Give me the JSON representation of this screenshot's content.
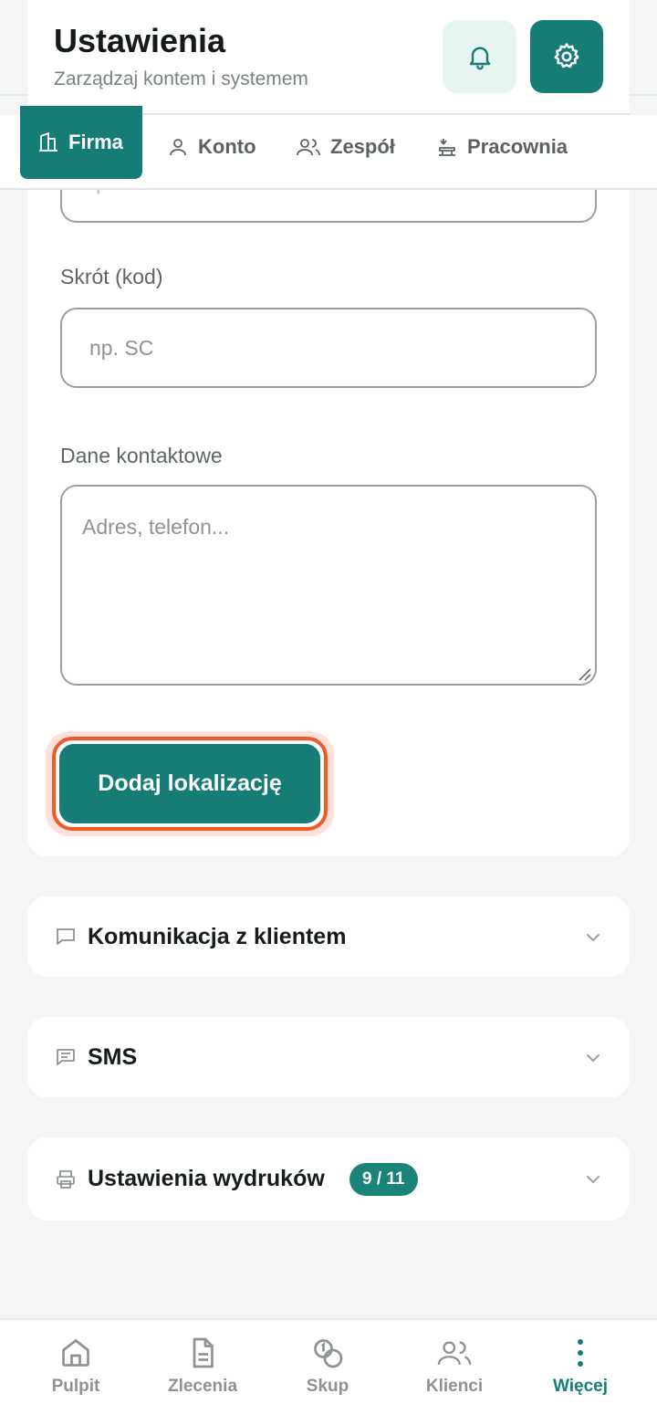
{
  "header": {
    "title": "Ustawienia",
    "subtitle": "Zarządzaj kontem i systemem",
    "bell_icon": "bell-icon",
    "settings_icon": "gear-icon"
  },
  "tabs": [
    {
      "label": "Firma",
      "icon": "building-icon",
      "active": true
    },
    {
      "label": "Konto",
      "icon": "user-icon",
      "active": false
    },
    {
      "label": "Zespół",
      "icon": "users-icon",
      "active": false
    },
    {
      "label": "Pracownia",
      "icon": "workbench-icon",
      "active": false
    }
  ],
  "form": {
    "partial_field_placeholder": "np. Serwis Centrum",
    "code_label": "Skrót (kod)",
    "code_placeholder": "np. SC",
    "contact_label": "Dane kontaktowe",
    "contact_placeholder": "Adres, telefon...",
    "add_button_label": "Dodaj lokalizację"
  },
  "sections": {
    "communication": {
      "title": "Komunikacja z klientem",
      "icon": "message-square-icon"
    },
    "sms": {
      "title": "SMS",
      "icon": "message-text-icon"
    },
    "print": {
      "title": "Ustawienia wydruków",
      "icon": "printer-icon",
      "badge": "9 / 11"
    }
  },
  "bottom_nav": [
    {
      "label": "Pulpit",
      "icon": "home-icon",
      "active": false
    },
    {
      "label": "Zlecenia",
      "icon": "document-icon",
      "active": false
    },
    {
      "label": "Skup",
      "icon": "coins-icon",
      "active": false
    },
    {
      "label": "Klienci",
      "icon": "users-icon",
      "active": false
    },
    {
      "label": "Więcej",
      "icon": "more-vertical-icon",
      "active": true
    }
  ],
  "colors": {
    "accent": "#167d76",
    "highlight_ring": "#f05a28",
    "background": "#f4f6f5"
  }
}
